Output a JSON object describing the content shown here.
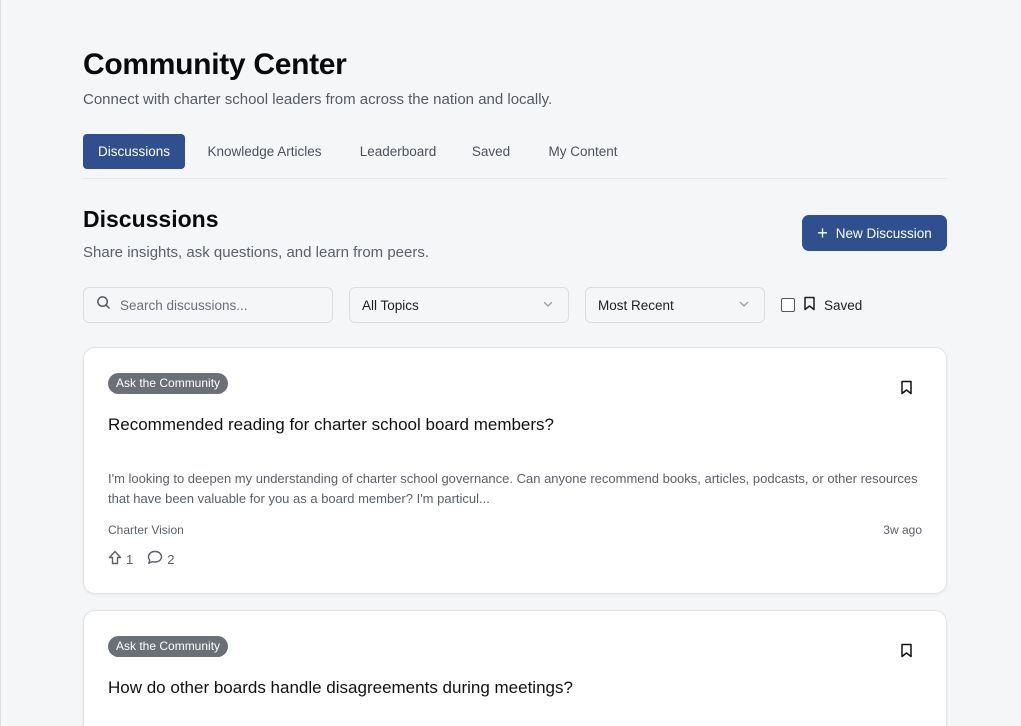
{
  "header": {
    "title": "Community Center",
    "subtitle": "Connect with charter school leaders from across the nation and locally."
  },
  "tabs": [
    {
      "label": "Discussions",
      "active": true
    },
    {
      "label": "Knowledge Articles",
      "active": false
    },
    {
      "label": "Leaderboard",
      "active": false
    },
    {
      "label": "Saved",
      "active": false
    },
    {
      "label": "My Content",
      "active": false
    }
  ],
  "section": {
    "title": "Discussions",
    "subtitle": "Share insights, ask questions, and learn from peers.",
    "new_button_label": "New Discussion"
  },
  "filters": {
    "search_placeholder": "Search discussions...",
    "topic_selected": "All Topics",
    "sort_selected": "Most Recent",
    "saved_label": "Saved",
    "saved_checked": false
  },
  "discussions": [
    {
      "badge": "Ask the Community",
      "title": "Recommended reading for charter school board members?",
      "excerpt": "I'm looking to deepen my understanding of charter school governance. Can anyone recommend books, articles, podcasts, or other resources that have been valuable for you as a board member? I'm particul...",
      "author": "Charter Vision",
      "time": "3w ago",
      "upvotes": "1",
      "comments": "2"
    },
    {
      "badge": "Ask the Community",
      "title": "How do other boards handle disagreements during meetings?"
    }
  ],
  "icons": {
    "search": "search-icon",
    "chevron": "chevron-down-icon",
    "bookmark": "bookmark-icon",
    "upvote": "arrow-up-icon",
    "comment": "comment-icon",
    "plus": "plus-icon"
  },
  "colors": {
    "primary": "#2f4f8f",
    "badge": "#6b6f78",
    "background": "#f5f6f8"
  }
}
